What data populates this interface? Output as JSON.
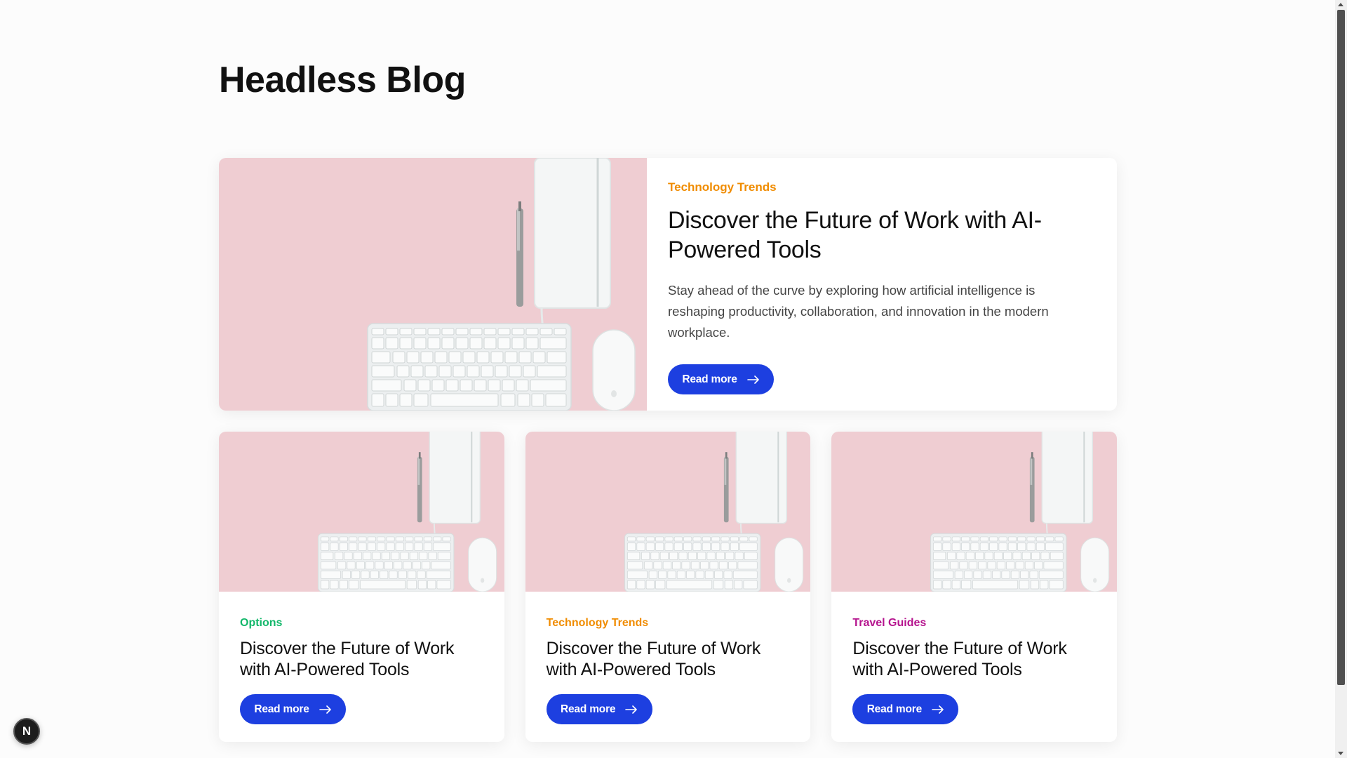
{
  "page": {
    "title": "Headless Blog"
  },
  "featured": {
    "category": "Technology Trends",
    "category_color": "#f08c00",
    "title": "Discover the Future of Work with AI-Powered Tools",
    "excerpt": "Stay ahead of the curve by exploring how artificial intelligence is reshaping productivity, collaboration, and innovation in the modern workplace.",
    "read_more_label": "Read more"
  },
  "posts": [
    {
      "category": "Options",
      "category_color": "#12b76a",
      "title": "Discover the Future of Work with AI-Powered Tools",
      "read_more_label": "Read more"
    },
    {
      "category": "Technology Trends",
      "category_color": "#f08c00",
      "title": "Discover the Future of Work with AI-Powered Tools",
      "read_more_label": "Read more"
    },
    {
      "category": "Travel Guides",
      "category_color": "#b5148e",
      "title": "Discover the Future of Work with AI-Powered Tools",
      "read_more_label": "Read more"
    }
  ],
  "dev_badge": {
    "letter": "N"
  },
  "colors": {
    "accent_button": "#1d3fe0",
    "image_background": "#efcdd2"
  },
  "icons": {
    "read_more": "arrow-right-icon",
    "thumbnail": "desk-keyboard-image"
  }
}
